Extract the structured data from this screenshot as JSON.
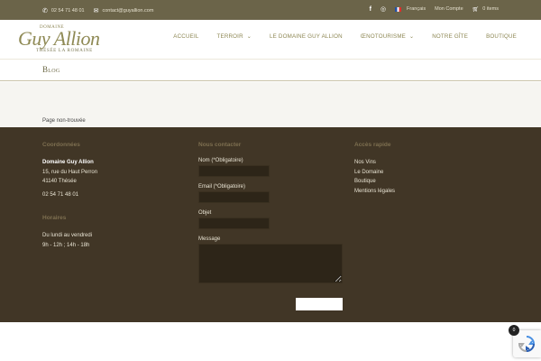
{
  "topbar": {
    "phone": "02 54 71 48 01",
    "email": "contact@guyallion.com",
    "language": "Français",
    "account": "Mon Compte",
    "cart": "0 items",
    "icons": [
      "phone-icon",
      "mail-icon",
      "facebook-icon",
      "instagram-icon",
      "cart-icon"
    ]
  },
  "logo": {
    "line1": "DOMAINE",
    "line2": "Guy Allion",
    "line3": "THÉSÉE LA ROMAINE"
  },
  "nav": {
    "items": [
      {
        "label": "ACCUEIL"
      },
      {
        "label": "TERROIR"
      },
      {
        "label": "LE DOMAINE GUY ALLION"
      },
      {
        "label": "ŒNOTOURISME"
      },
      {
        "label": "NOTRE GÎTE"
      },
      {
        "label": "BOUTIQUE"
      }
    ]
  },
  "page": {
    "title": "Blog",
    "not_found": "Page non-trouvée"
  },
  "footer": {
    "coords_title": "Coordonnées",
    "company": "Domaine Guy Allion",
    "address1": "15, rue du Haut Perron",
    "address2": "41140 Thésée",
    "phone": "02 54 71 48 01",
    "hours_title": "Horaires",
    "hours1": "Du lundi au vendredi",
    "hours2": "9h - 12h ; 14h - 18h",
    "contact_title": "Nous contacter",
    "name_label": "Nom (*Obligatoire)",
    "email_label": "Email (*Obligatoire)",
    "subject_label": "Objet",
    "message_label": "Message",
    "quick_title": "Accès rapide",
    "links": [
      "Nos Vins",
      "Le Domaine",
      "Boutique",
      "Mentions légales"
    ]
  },
  "cart_bubble": "0",
  "colors": {
    "topbar": "#6b6449",
    "accent": "#8c8652",
    "footer": "#413626"
  }
}
